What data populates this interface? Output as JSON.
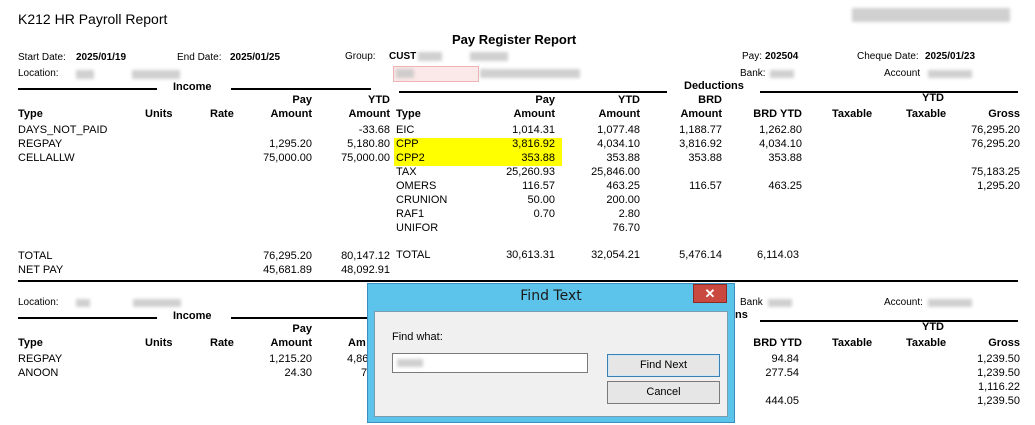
{
  "report": {
    "app_title": "K212 HR Payroll Report",
    "title": "Pay Register Report",
    "start_date_label": "Start Date:",
    "start_date": "2025/01/19",
    "end_date_label": "End Date:",
    "end_date": "2025/01/25",
    "group_label": "Group:",
    "group_value": "CUST",
    "pay_label": "Pay:",
    "pay_value": "202504",
    "cheque_label": "Cheque Date:",
    "cheque_value": "2025/01/23",
    "location_label": "Location:",
    "bank_label": "Bank:",
    "account_label": "Account",
    "account_label_2": "Account:",
    "bank_label_2": "Bank"
  },
  "sections": {
    "income": "Income",
    "deductions": "Deductions",
    "deductions_partial": "ns"
  },
  "income_headers": {
    "type": "Type",
    "units": "Units",
    "rate": "Rate",
    "pay": "Pay",
    "amount": "Amount",
    "ytd": "YTD",
    "amount2": "Amount",
    "amount_partial": "Am"
  },
  "deduction_headers": {
    "type": "Type",
    "pay": "Pay",
    "amount": "Amount",
    "ytd": "YTD",
    "amount2": "Amount",
    "brd": "BRD",
    "brd_amount": "Amount",
    "brd_ytd": "BRD YTD",
    "taxable": "Taxable",
    "ytd3": "YTD",
    "taxable2": "Taxable",
    "gross": "Gross"
  },
  "income_rows": [
    {
      "type": "DAYS_NOT_PAID",
      "pay": "",
      "ytd": "-33.68"
    },
    {
      "type": "REGPAY",
      "pay": "1,295.20",
      "ytd": "5,180.80"
    },
    {
      "type": "CELLALLW",
      "pay": "75,000.00",
      "ytd": "75,000.00"
    }
  ],
  "deduction_rows": [
    {
      "type": "EIC",
      "pay": "1,014.31",
      "ytd": "1,077.48",
      "brd": "1,188.77",
      "brd_ytd": "1,262.80",
      "gross": "76,295.20"
    },
    {
      "type": "CPP",
      "pay": "3,816.92",
      "ytd": "4,034.10",
      "brd": "3,816.92",
      "brd_ytd": "4,034.10",
      "gross": "76,295.20"
    },
    {
      "type": "CPP2",
      "pay": "353.88",
      "ytd": "353.88",
      "brd": "353.88",
      "brd_ytd": "353.88",
      "gross": ""
    },
    {
      "type": "TAX",
      "pay": "25,260.93",
      "ytd": "25,846.00",
      "brd": "",
      "brd_ytd": "",
      "gross": "75,183.25"
    },
    {
      "type": "OMERS",
      "pay": "116.57",
      "ytd": "463.25",
      "brd": "116.57",
      "brd_ytd": "463.25",
      "gross": "1,295.20"
    },
    {
      "type": "CRUNION",
      "pay": "50.00",
      "ytd": "200.00",
      "brd": "",
      "brd_ytd": "",
      "gross": ""
    },
    {
      "type": "RAF1",
      "pay": "0.70",
      "ytd": "2.80",
      "brd": "",
      "brd_ytd": "",
      "gross": ""
    },
    {
      "type": "UNIFOR",
      "pay": "",
      "ytd": "76.70",
      "brd": "",
      "brd_ytd": "",
      "gross": ""
    }
  ],
  "totals": {
    "total_label": "TOTAL",
    "net_label": "NET PAY",
    "income_total_pay": "76,295.20",
    "income_total_ytd": "80,147.12",
    "net_pay": "45,681.89",
    "net_ytd": "48,092.91",
    "ded_total_label": "TOTAL",
    "ded_total_pay": "30,613.31",
    "ded_total_ytd": "32,054.21",
    "ded_total_brd": "5,476.14",
    "ded_total_brd_ytd": "6,114.03"
  },
  "income_rows_2": [
    {
      "type": "REGPAY",
      "pay": "1,215.20",
      "ytd_partial": "4,86"
    },
    {
      "type": "ANOON",
      "pay": "24.30",
      "ytd_partial": "7"
    }
  ],
  "right_rows_2": [
    {
      "brd_ytd": "94.84",
      "gross": "1,239.50"
    },
    {
      "brd_ytd": "277.54",
      "gross": "1,239.50"
    },
    {
      "brd_ytd": "",
      "gross": "1,116.22"
    },
    {
      "brd_ytd": "444.05",
      "gross": "1,239.50"
    }
  ],
  "dialog": {
    "title": "Find Text",
    "close_glyph": "✕",
    "find_label": "Find what:",
    "find_value": "",
    "find_next": "Find Next",
    "cancel": "Cancel"
  }
}
